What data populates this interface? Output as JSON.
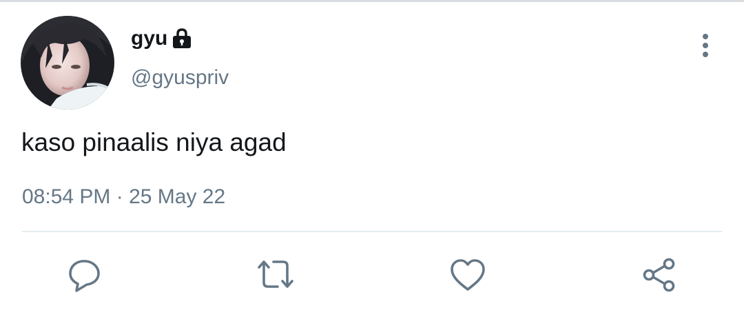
{
  "tweet": {
    "author": {
      "display_name": "gyu",
      "handle": "@gyuspriv",
      "protected_icon": "lock-icon",
      "avatar": "profile-photo"
    },
    "text": "kaso pinaalis niya agad",
    "timestamp": "08:54 PM · 25 May 22",
    "menu_icon": "more-vertical-icon"
  },
  "actions": [
    {
      "name": "reply",
      "icon": "reply-icon"
    },
    {
      "name": "retweet",
      "icon": "retweet-icon"
    },
    {
      "name": "like",
      "icon": "heart-icon"
    },
    {
      "name": "share",
      "icon": "share-icon"
    }
  ],
  "colors": {
    "text_primary": "#14171a",
    "text_secondary": "#657786",
    "divider": "#e6ecf0",
    "icon": "#657786"
  }
}
